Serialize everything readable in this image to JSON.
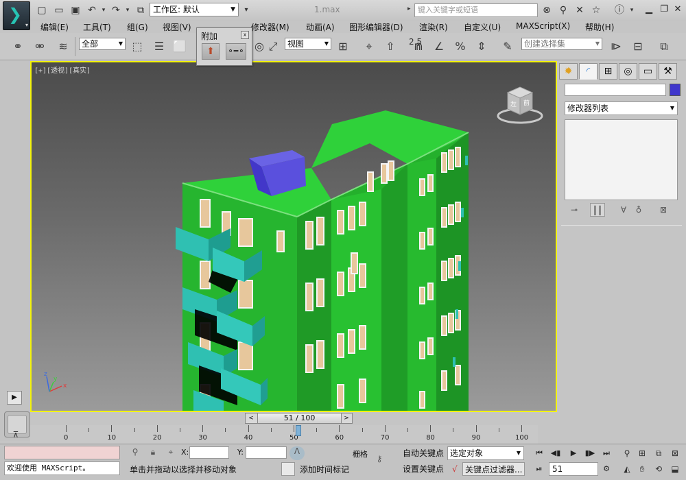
{
  "title_bar": {
    "workspace_label": "工作区: 默认",
    "document_title": "1.max",
    "search_placeholder": "键入关键字或短语"
  },
  "menu": [
    "编辑(E)",
    "工具(T)",
    "组(G)",
    "视图(V)",
    "修改器(M)",
    "动画(A)",
    "图形编辑器(D)",
    "渲染(R)",
    "自定义(U)",
    "MAXScript(X)",
    "帮助(H)"
  ],
  "toolbar": {
    "selection_filter": "全部",
    "reference_coord": "视图",
    "snap_angle_label": "2.5",
    "named_selection_placeholder": "创建选择集"
  },
  "attach_popup": {
    "title": "附加",
    "close_symbol": "x"
  },
  "viewport": {
    "label": "[+][透视][真实]",
    "viewcube_faces": [
      "左",
      "前"
    ],
    "axis_labels": [
      "x",
      "y",
      "z"
    ]
  },
  "command_panel": {
    "modifier_list": "修改器列表",
    "object_color": "#3f36cc"
  },
  "time_slider": {
    "current_frame": 51,
    "total_frames": 100,
    "label": "51 / 100"
  },
  "track_bar": {
    "tick_labels": [
      "0",
      "10",
      "20",
      "30",
      "40",
      "50",
      "60",
      "70",
      "80",
      "90",
      "100"
    ]
  },
  "status_bar": {
    "maxscript_text": "欢迎使用 MAXScript。",
    "coord_x_label": "X:",
    "coord_y_label": "Y:",
    "prompt_text": "单击并拖动以选择并移动对象",
    "add_time_tag": "添加时间标记",
    "grid_label": "栅格",
    "auto_key": "自动关键点",
    "set_key": "设置关键点",
    "key_filter_select": "选定对象",
    "key_filters_button": "关键点过滤器...",
    "current_frame_field": "51"
  }
}
